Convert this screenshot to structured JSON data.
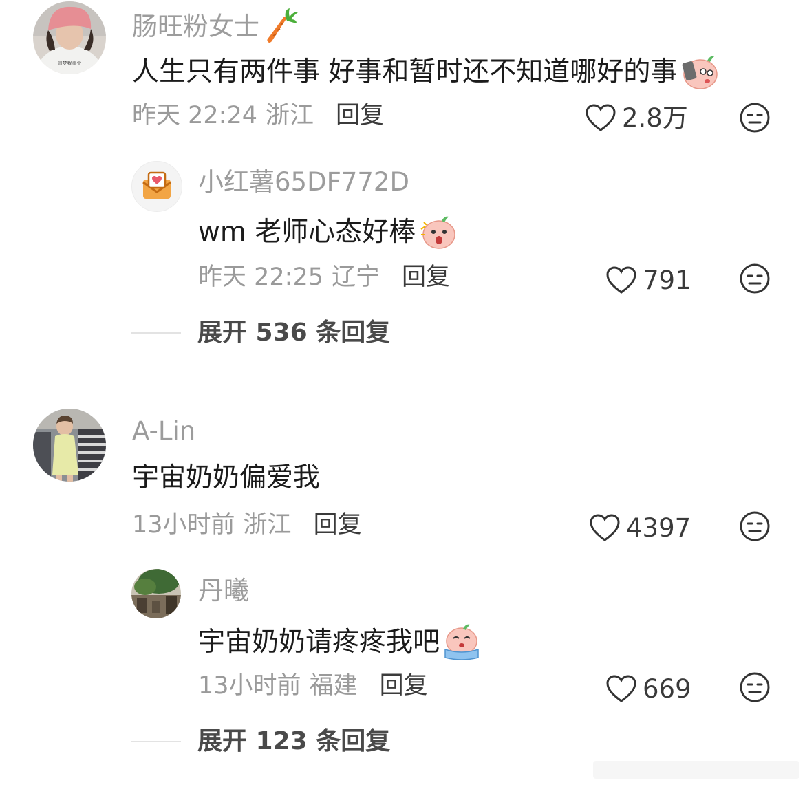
{
  "comments": [
    {
      "username": "肠旺粉女士",
      "username_emoji": "carrot-icon",
      "text": "人生只有两件事 好事和暂时还不知道哪好的事",
      "text_emoji": "peach-phone-emoji",
      "time": "昨天 22:24",
      "location": "浙江",
      "reply_label": "回复",
      "likes": "2.8万",
      "avatar": "avatar-girl-pink-cap",
      "replies": [
        {
          "username": "小红薯65DF772D",
          "text": "wm 老师心态好棒",
          "text_emoji": "peach-surprised-emoji",
          "time": "昨天 22:25",
          "location": "辽宁",
          "reply_label": "回复",
          "likes": "791",
          "avatar": "envelope-heart-avatar"
        }
      ],
      "expand_label": "展开 536 条回复"
    },
    {
      "username": "A-Lin",
      "text": "宇宙奶奶偏爱我",
      "time": "13小时前",
      "location": "浙江",
      "reply_label": "回复",
      "likes": "4397",
      "avatar": "avatar-girl-shop",
      "replies": [
        {
          "username": "丹曦",
          "text": "宇宙奶奶请疼疼我吧",
          "text_emoji": "peach-crying-emoji",
          "time": "13小时前",
          "location": "福建",
          "reply_label": "回复",
          "likes": "669",
          "avatar": "avatar-garden"
        }
      ],
      "expand_label": "展开 123 条回复"
    }
  ],
  "colors": {
    "username": "#9c9c9c",
    "text": "#1b1b1b",
    "meta": "#9a9a9a",
    "accent_orange": "#f07b2a"
  }
}
